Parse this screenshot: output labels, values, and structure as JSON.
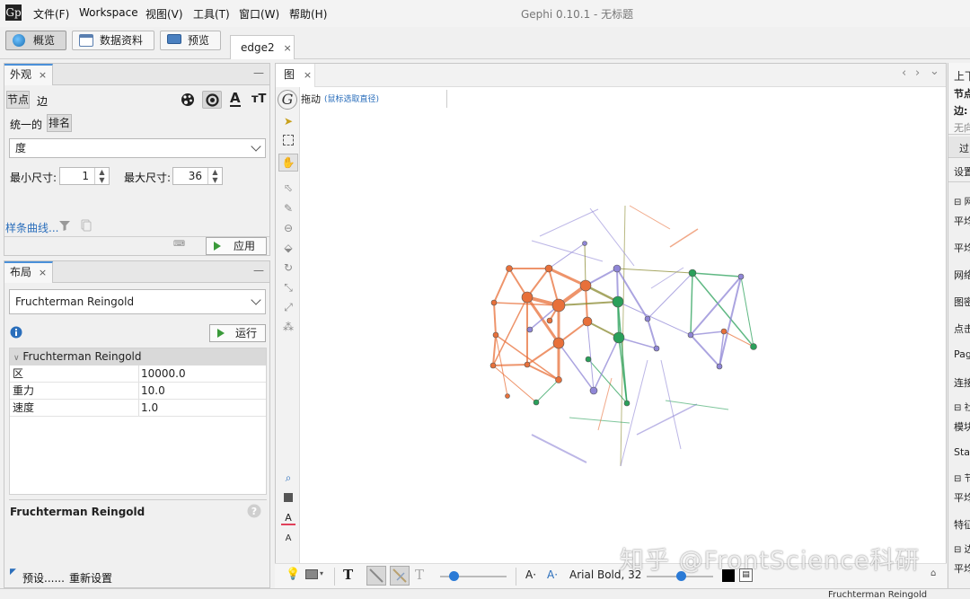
{
  "window": {
    "app_logo": "Gp",
    "title": "Gephi 0.10.1 - 无标题",
    "menus": [
      "文件(F)",
      "Workspace",
      "视图(V)",
      "工具(T)",
      "窗口(W)",
      "帮助(H)"
    ]
  },
  "modes": [
    {
      "label": "概览",
      "icon": "globe-icon",
      "color": "#2a8fd0"
    },
    {
      "label": "数据资料",
      "icon": "table-icon",
      "color": "#5a7fb0"
    },
    {
      "label": "预览",
      "icon": "monitor-icon",
      "color": "#4a80c0"
    }
  ],
  "workspace_tab": {
    "label": "edge2",
    "close": "×"
  },
  "appearance": {
    "tab": "外观",
    "close": "×",
    "minimize": "—",
    "subtabs": [
      "节点",
      "边"
    ],
    "modes": [
      "统一的",
      "排名"
    ],
    "attribute": "度",
    "min_size_label": "最小尺寸:",
    "min_size": "1",
    "max_size_label": "最大尺寸:",
    "max_size": "36",
    "spline_link": "样条曲线...",
    "apply_label": "应用",
    "text_icon_label": "A",
    "size_icon_label": "тT"
  },
  "layout": {
    "tab": "布局",
    "close": "×",
    "minimize": "—",
    "algorithm": "Fruchterman Reingold",
    "run_label": "运行",
    "group_label": "Fruchterman Reingold",
    "properties": [
      {
        "name": "区",
        "value": "10000.0"
      },
      {
        "name": "重力",
        "value": "10.0"
      },
      {
        "name": "速度",
        "value": "1.0"
      }
    ],
    "description_title": "Fruchterman Reingold",
    "presets_label": "预设......",
    "reset_label": "重新设置"
  },
  "graph": {
    "tab": "图",
    "close": "×",
    "drag_label": "拖动",
    "drag_hint": "(鼠标选取直径)",
    "nav": [
      "‹",
      "›",
      "⌄"
    ]
  },
  "bottom_toolbar": {
    "font_label": "Arial Bold, 32",
    "font_a": "A·",
    "font_b": "A·"
  },
  "right_panel": {
    "labels": [
      "上下",
      "节点",
      "边:",
      "无向",
      "过",
      "设置",
      "网",
      "平均",
      "平均",
      "网络",
      "图密",
      "点击",
      "Pag",
      "连接",
      "社",
      "模块",
      "Stat",
      "节",
      "平均",
      "特征",
      "边",
      "平均"
    ]
  },
  "status": {
    "text": "Fruchterman Reingold"
  },
  "watermark": "知乎 @FrontScience科研",
  "colors": {
    "orange": "#e8703a",
    "green": "#2aa05a",
    "purple": "#8f86d6",
    "olive": "#8a8a30",
    "accent": "#4a90d9"
  }
}
